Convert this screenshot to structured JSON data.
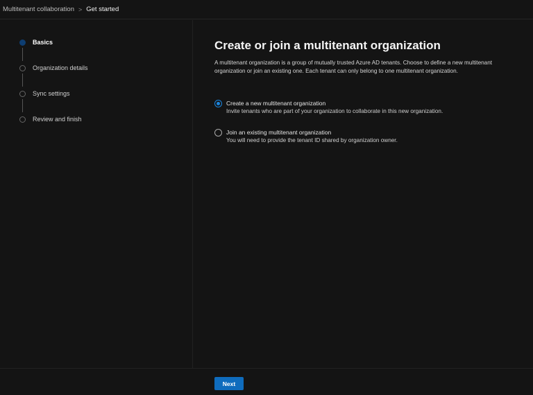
{
  "breadcrumb": {
    "parent": "Multitenant collaboration",
    "separator": ">",
    "current": "Get started"
  },
  "steps": [
    {
      "label": "Basics"
    },
    {
      "label": "Organization details"
    },
    {
      "label": "Sync settings"
    },
    {
      "label": "Review and finish"
    }
  ],
  "main": {
    "title": "Create or join a multitenant organization",
    "description": "A multitenant organization is a group of mutually trusted Azure AD tenants. Choose to define a new multitenant organization or join an existing one. Each tenant can only belong to one multitenant organization.",
    "options": [
      {
        "title": "Create a new multitenant organization",
        "subtitle": "Invite tenants who are part of your organization to collaborate in this new organization.",
        "selected": true
      },
      {
        "title": "Join an existing multitenant organization",
        "subtitle": "You will need to provide the tenant ID shared by organization owner.",
        "selected": false
      }
    ]
  },
  "footer": {
    "next_label": "Next"
  },
  "colors": {
    "accent": "#0f6cbd",
    "background": "#141414"
  }
}
